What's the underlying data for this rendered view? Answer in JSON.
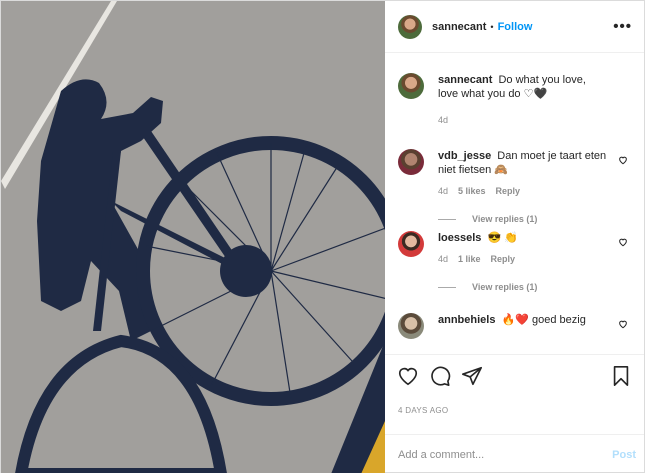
{
  "header": {
    "username": "sannecant",
    "separator": "•",
    "follow_label": "Follow",
    "more_icon": "more-icon",
    "more_label": "•••"
  },
  "caption": {
    "username": "sannecant",
    "text": "Do what you love, love what you do ♡🖤",
    "time": "4d"
  },
  "comments": [
    {
      "username": "vdb_jesse",
      "text": "Dan moet je taart eten niet fietsen",
      "emoji": "🙈",
      "time": "4d",
      "likes": "5 likes",
      "reply_label": "Reply",
      "view_replies": "View replies (1)"
    },
    {
      "username": "loessels",
      "text": "",
      "emoji": "😎 👏",
      "time": "4d",
      "likes": "1 like",
      "reply_label": "Reply",
      "view_replies": "View replies (1)"
    },
    {
      "username": "annbehiels",
      "text": "goed bezig",
      "emoji": "🔥❤️",
      "time": "",
      "likes": "",
      "reply_label": "",
      "view_replies": ""
    }
  ],
  "actions": {
    "like_icon": "heart-icon",
    "comment_icon": "comment-icon",
    "share_icon": "share-icon",
    "save_icon": "bookmark-icon"
  },
  "date_label": "4 DAYS AGO",
  "add_comment": {
    "placeholder": "Add a comment...",
    "post_label": "Post"
  },
  "colors": {
    "accent": "#0095f6",
    "post_disabled": "#b2dffc",
    "text": "#262626",
    "muted": "#8e8e8e"
  }
}
